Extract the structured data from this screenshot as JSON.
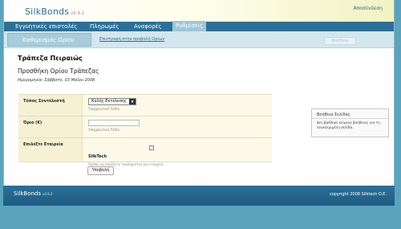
{
  "header": {
    "logo": "SilkBonds",
    "version": "v0.9.2",
    "logout": "Αποσύνδεση"
  },
  "nav": {
    "tabs": [
      {
        "label": "Εγγυητικές επιστολές"
      },
      {
        "label": "Πληρωμές"
      },
      {
        "label": "Αναφορές"
      },
      {
        "label": "Ρυθμίσεις",
        "active": true
      }
    ]
  },
  "subbar": {
    "section_title": "Καθορισμός Ορίου",
    "back_link": "Επιστροφή στην προβολή Ορίων",
    "help_tab": "Βοήθεια"
  },
  "page": {
    "bank_name": "Τράπεζα Πειραιώς",
    "action_title": "Προσθήκη Ορίου Τράπεζας",
    "date": "Ημερομηνία: Σάββατο, 03 Μαΐου 2008"
  },
  "form": {
    "type_label": "Τύπος Συντελεστή",
    "type_value": "Καλής Εκτέλεσης",
    "type_hint": "Υποχρεωτικό Πεδίο",
    "limit_label": "Όριο (€)",
    "limit_value": "",
    "limit_hint": "Υποχρεωτικό Πεδίο",
    "company_label": "Επιλέξτε Εταιρεία",
    "company_name": "SilkTech",
    "company_hint": "Πρέπει να επιλέξετε τουλάχιστον μία εταιρεία",
    "submit": "Υποβολή"
  },
  "help_box": {
    "title": "Βοήθεια Σελίδας",
    "text": "Δεν βρέθηκε κείμενο βοήθειας για τη συγκεκριμένη σελίδα."
  },
  "footer": {
    "brand": "SilkBonds",
    "version": "v0.9.2",
    "copyright": "copyright 2008   Silktech O.E."
  },
  "colors": {
    "nav_bg": "#2d6f97",
    "active_tab": "#9fc6d8",
    "page_bg": "#5aa3bd",
    "form_label_bg": "#f7f1d3"
  }
}
